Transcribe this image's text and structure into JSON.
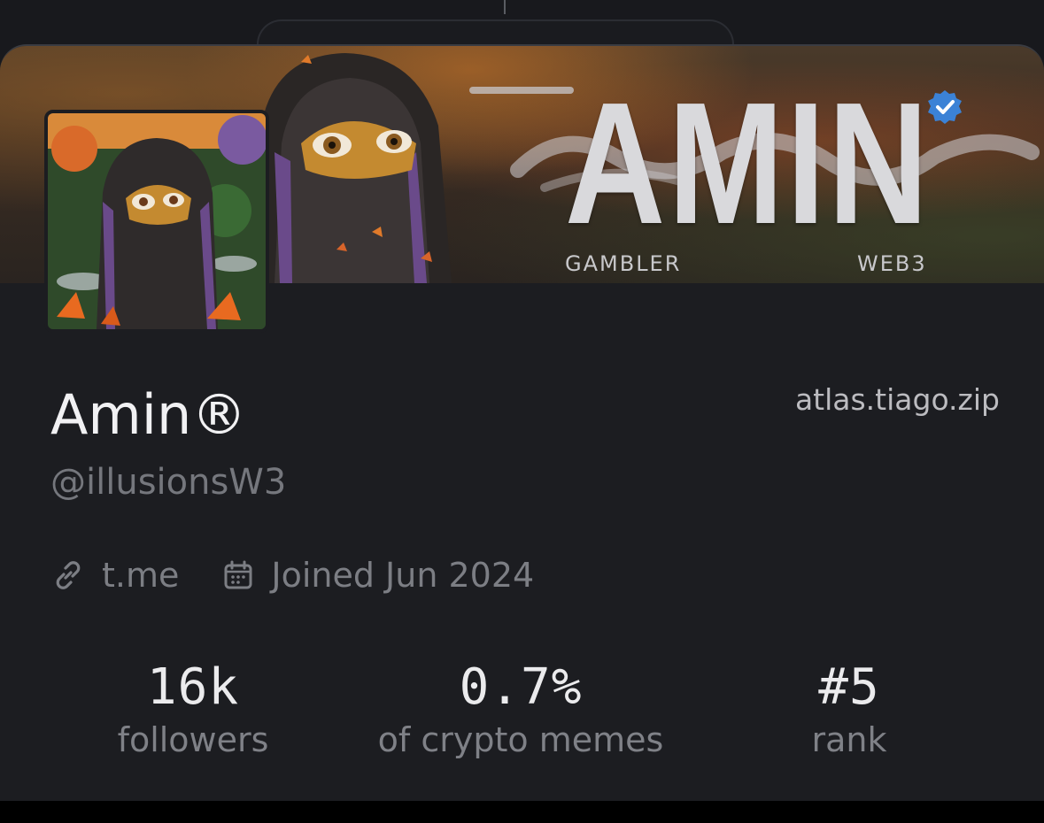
{
  "banner": {
    "title": "AMIN",
    "tag_left": "GAMBLER",
    "tag_right": "WEB3",
    "verified_icon": "verified-badge-icon",
    "accent_color": "#3b82d6"
  },
  "profile": {
    "display_name": "Amin®",
    "handle": "@illusionsW3",
    "external_link": "atlas.tiago.zip",
    "website": "t.me",
    "website_icon": "link-icon",
    "joined": "Joined Jun 2024",
    "joined_icon": "calendar-icon"
  },
  "stats": [
    {
      "value": "16k",
      "label": "followers"
    },
    {
      "value": "0.7%",
      "label": "of crypto memes"
    },
    {
      "value": "#5",
      "label": "rank"
    }
  ]
}
